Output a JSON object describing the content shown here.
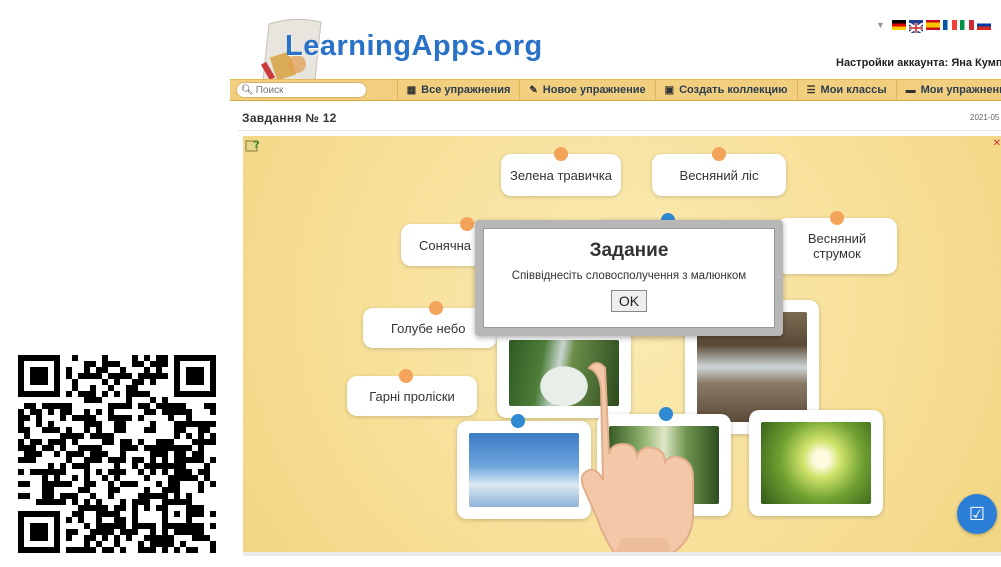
{
  "header": {
    "logo_text": "LearningApps.org",
    "account_text": "Настройки аккаунта: Яна Кумпан",
    "languages": [
      "german-flag",
      "uk-flag",
      "spanish-flag",
      "french-flag",
      "italian-flag",
      "russian-flag"
    ]
  },
  "navbar": {
    "search_placeholder": "Поиск",
    "items": [
      {
        "label": "Все упражнения",
        "icon": "grid-icon"
      },
      {
        "label": "Новое упражнение",
        "icon": "pencil-icon"
      },
      {
        "label": "Создать коллекцию",
        "icon": "collection-icon"
      },
      {
        "label": "Мои классы",
        "icon": "list-icon"
      },
      {
        "label": "Мои упражнения",
        "icon": "folder-icon"
      }
    ]
  },
  "page": {
    "title": "Завдання № 12",
    "date": "2021-05"
  },
  "exercise": {
    "text_cards": [
      "Зелена травичка",
      "Весняний ліс",
      "Сонячна",
      "Весняний струмок",
      "Голубе небо",
      "Гарні проліски"
    ],
    "image_cards": [
      "snowdrops-image",
      "stream-image",
      "sky-image",
      "forest-image",
      "sun-trees-image"
    ]
  },
  "modal": {
    "title": "Задание",
    "text": "Співвіднесіть словосполучення з малюнком",
    "ok_label": "OK"
  },
  "colors": {
    "navbar": "#f2cf7e",
    "app_bg": "#f8e6a3",
    "orange_dot": "#f4a45a",
    "blue_dot": "#2f8ad2",
    "check_button": "#2c7fd6"
  }
}
